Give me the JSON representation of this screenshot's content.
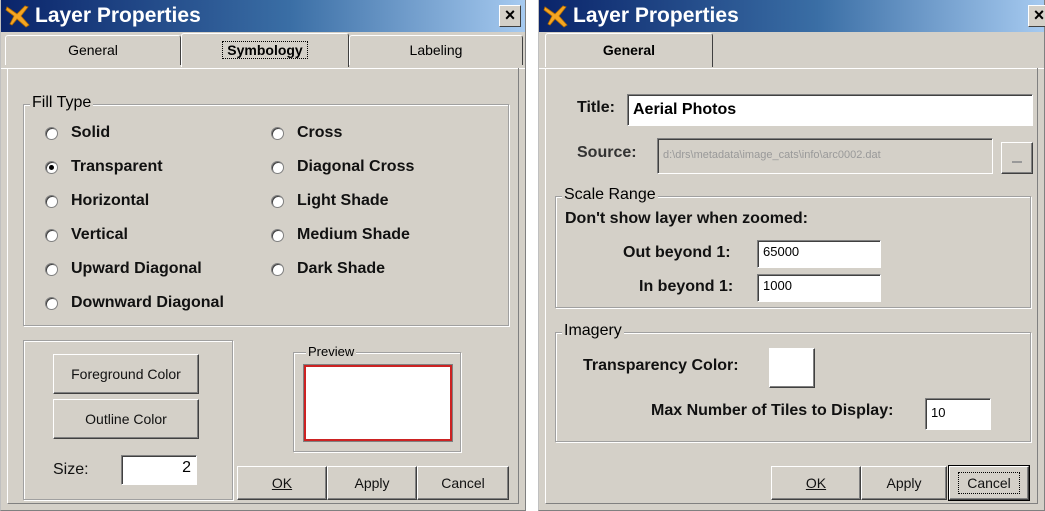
{
  "dialog_left": {
    "title": "Layer Properties",
    "close_glyph": "×",
    "tabs": [
      "General",
      "Symbology",
      "Labeling"
    ],
    "active_tab": "Symbology",
    "fill_type": {
      "legend": "Fill Type",
      "options": [
        "Solid",
        "Transparent",
        "Horizontal",
        "Vertical",
        "Upward Diagonal",
        "Downward Diagonal",
        "Cross",
        "Diagonal Cross",
        "Light Shade",
        "Medium Shade",
        "Dark Shade"
      ],
      "selected": "Transparent"
    },
    "foreground_color_button": "Foreground Color",
    "outline_color_button": "Outline Color",
    "size_label": "Size:",
    "size_value": "2",
    "preview_legend": "Preview",
    "ok_button": "OK",
    "apply_button": "Apply",
    "cancel_button": "Cancel"
  },
  "dialog_right": {
    "title": "Layer Properties",
    "close_glyph": "×",
    "tabs": [
      "General"
    ],
    "active_tab": "General",
    "title_label": "Title:",
    "title_value": "Aerial Photos",
    "source_label": "Source:",
    "source_value": "d:\\drs\\metadata\\image_cats\\info\\arc0002.dat",
    "scale_range": {
      "legend": "Scale Range",
      "heading": "Don't show layer when zoomed:",
      "out_label": "Out beyond  1:",
      "out_value": "65000",
      "in_label": "In beyond  1:",
      "in_value": "1000"
    },
    "imagery": {
      "legend": "Imagery",
      "transparency_label": "Transparency Color:",
      "max_tiles_label": "Max Number of Tiles to Display:",
      "max_tiles_value": "10"
    },
    "ok_button": "OK",
    "apply_button": "Apply",
    "cancel_button": "Cancel"
  },
  "colors": {
    "dialog_face": "#d4d0c8",
    "title_dark": "#0a246a",
    "title_light": "#a6caf0",
    "icon_orange": "#f5a623",
    "preview_red": "#cc2222"
  },
  "icons": [
    "airplane-icon",
    "close-icon",
    "browse-icon"
  ]
}
